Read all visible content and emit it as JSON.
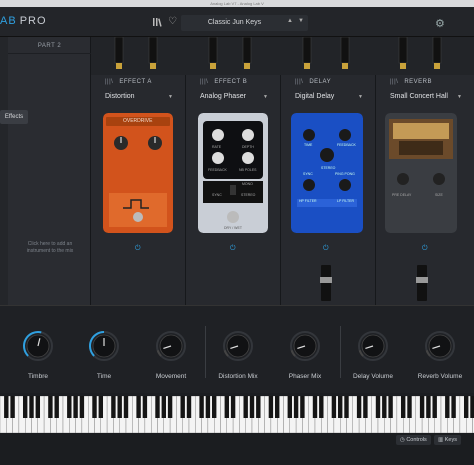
{
  "window": {
    "title": "Analog Lab V7 - Analog Lab V"
  },
  "header": {
    "logo_ab": "AB",
    "logo_pro": "PRO",
    "preset_name": "Classic Jun Keys"
  },
  "left": {
    "part_label": "PART 2",
    "hint": "Click here to add an instrument to the mix",
    "effects_tab": "Effects"
  },
  "slots": [
    {
      "title": "EFFECT A",
      "selection": "Distortion",
      "pedal_brand": "OVERDRIVE",
      "knobs": []
    },
    {
      "title": "EFFECT B",
      "selection": "Analog Phaser",
      "knobs": [
        "RATE",
        "DEPTH",
        "FEEDBACK",
        "NB POLES",
        "SYNC",
        "STEREO",
        "DRY / WET"
      ],
      "mono": "MONO"
    },
    {
      "title": "DELAY",
      "selection": "Digital Delay",
      "knobs": [
        "TIME",
        "FEEDBACK",
        "SYNC",
        "STEREO",
        "PING PONG",
        "HP FILTER",
        "LP FILTER"
      ]
    },
    {
      "title": "REVERB",
      "selection": "Small Concert Hall",
      "knobs": [
        "PRE DELAY",
        "SIZE"
      ]
    }
  ],
  "controls": [
    {
      "label": "Timbre",
      "value": 0.55,
      "color": "#2fa0e0"
    },
    {
      "label": "Time",
      "value": 0.5,
      "color": "#2fa0e0"
    },
    {
      "label": "Movement",
      "value": 0.1,
      "color": "#444"
    },
    {
      "label": "Distortion Mix",
      "value": 0.1,
      "color": "#444"
    },
    {
      "label": "Phaser Mix",
      "value": 0.1,
      "color": "#444"
    },
    {
      "label": "Delay Volume",
      "value": 0.1,
      "color": "#444"
    },
    {
      "label": "Reverb Volume",
      "value": 0.1,
      "color": "#444"
    }
  ],
  "status": {
    "controls_btn": "Controls",
    "keys_btn": "Keys"
  },
  "colors": {
    "accent": "#2fa0e0",
    "distortion": "#d2531c",
    "phaser": "#c9ced6",
    "delay": "#1a4fc4",
    "reverb": "#3a3d42"
  }
}
